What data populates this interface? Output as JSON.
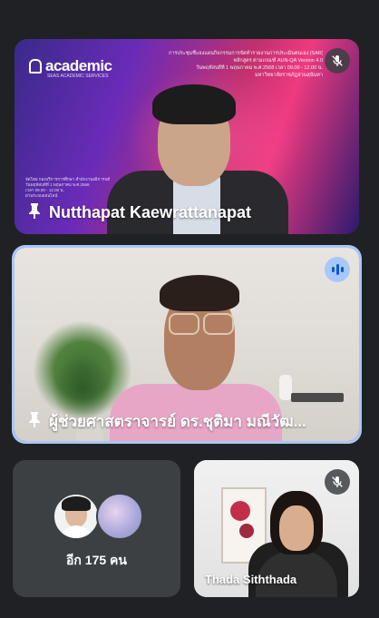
{
  "tiles": [
    {
      "name": "Nutthapat Kaewrattanapat",
      "muted": true,
      "pinned": true,
      "background": {
        "logo": "academic",
        "logo_sub": "SEAS ACADEMIC SERVICES",
        "banner_lines": [
          "การประชุมชี้แจงแผนกิจกรรมการจัดทำรายงานการประเมินตนเอง (SAR)",
          "หลักสูตร ตามเกณฑ์ AUN-QA Version 4.0",
          "วันพฤหัสบดีที่ 1 พฤษภาคม พ.ศ.2568 เวลา 09.00 - 12.00 น.",
          "มหาวิทยาลัยราชภัฏสวนสุนันทา"
        ],
        "info_lines": [
          "จัดโดย กองบริการการศึกษา สำนักงานอธิการบดี",
          "วันพฤหัสบดีที่ 1 พฤษภาคม พ.ศ.2568",
          "เวลา 09.00 - 12.00 น.",
          "ผ่านระบบออนไลน์"
        ]
      }
    },
    {
      "name": "ผู้ช่วยศาสตราจารย์ ดร.ชุติมา มณีวัฒ...",
      "speaking": true,
      "pinned": true
    },
    {
      "more_label": "อีก 175 คน"
    },
    {
      "name": "Thada Siththada",
      "muted": true
    }
  ],
  "colors": {
    "background": "#202124",
    "tile": "#3c4043",
    "active_border": "#a8c7fa",
    "speaking": "#0b57d0"
  }
}
